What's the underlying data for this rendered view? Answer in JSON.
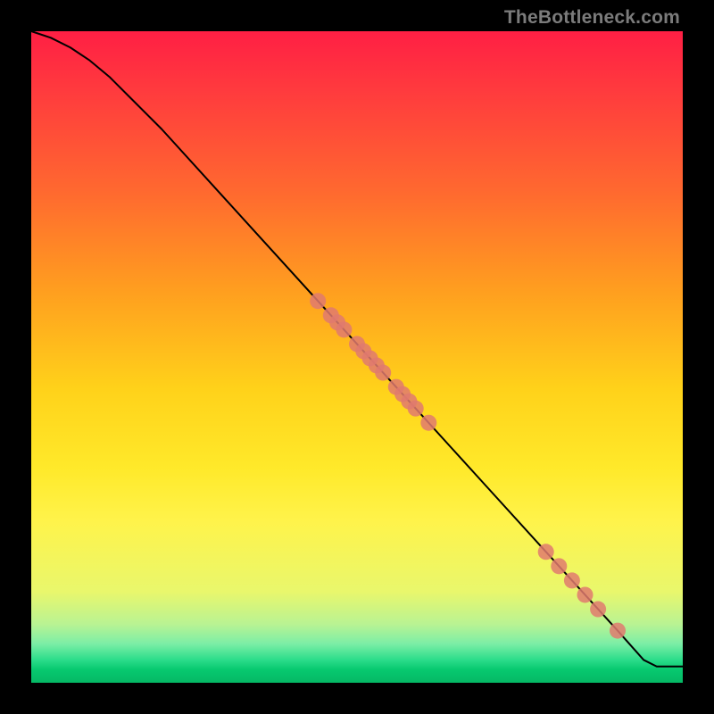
{
  "watermark": "TheBottleneck.com",
  "chart_data": {
    "type": "line",
    "title": "",
    "xlabel": "",
    "ylabel": "",
    "xlim": [
      0,
      100
    ],
    "ylim": [
      0,
      100
    ],
    "grid": false,
    "legend": false,
    "series": [
      {
        "name": "curve",
        "style": "line",
        "color": "#000000",
        "x": [
          0,
          3,
          6,
          9,
          12,
          15,
          20,
          30,
          40,
          50,
          60,
          70,
          80,
          90,
          94,
          96,
          100
        ],
        "y": [
          100,
          99,
          97.5,
          95.5,
          93,
          90,
          85,
          74,
          63,
          52,
          41,
          30,
          19,
          8,
          3.5,
          2.5,
          2.5
        ]
      },
      {
        "name": "points",
        "style": "scatter",
        "color": "#e07a6e",
        "x": [
          44,
          46,
          47,
          48,
          50,
          51,
          52,
          53,
          54,
          56,
          57,
          58,
          59,
          61,
          79,
          81,
          83,
          85,
          87,
          90
        ],
        "y": [
          58.6,
          56.4,
          55.3,
          54.2,
          52,
          50.9,
          49.8,
          48.7,
          47.6,
          45.4,
          44.3,
          43.2,
          42.1,
          39.9,
          20.1,
          17.9,
          15.7,
          13.5,
          11.3,
          8
        ]
      }
    ]
  }
}
